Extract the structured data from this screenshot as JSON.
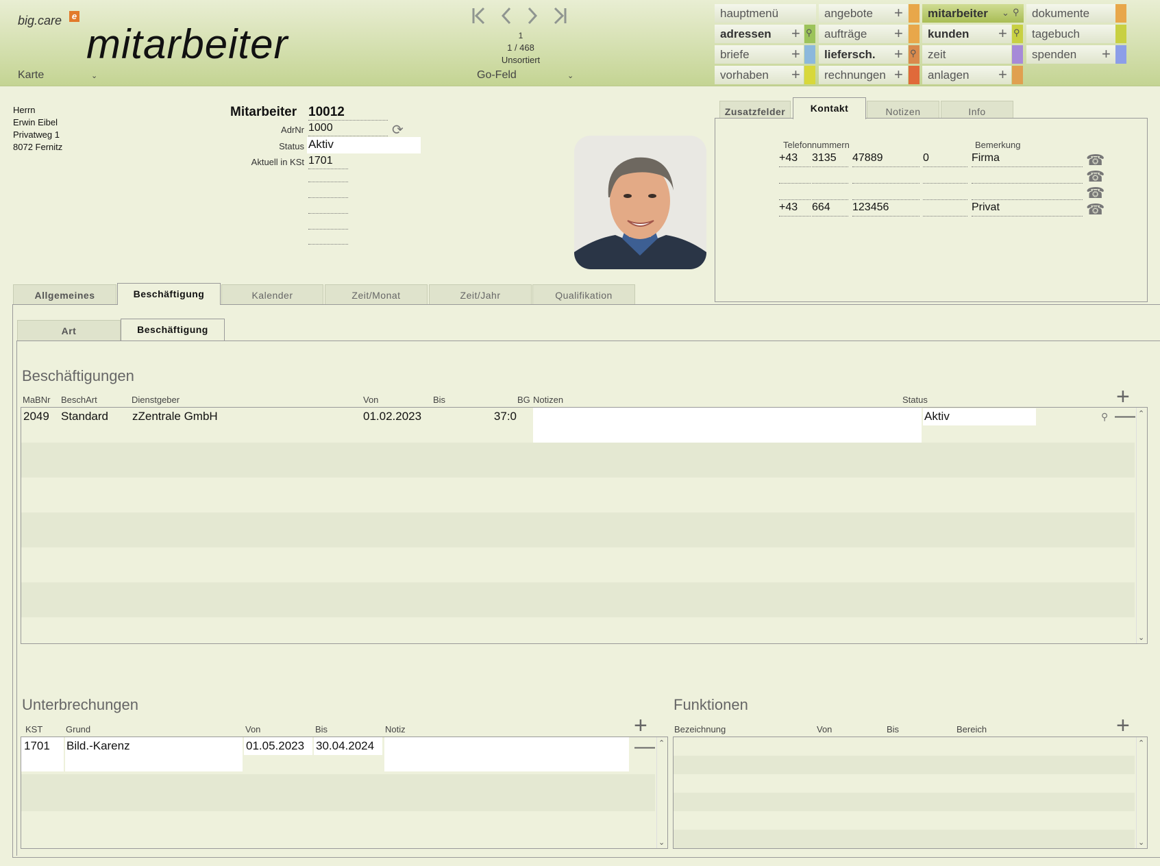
{
  "header": {
    "logo_text": "big.care",
    "logo_mark": "e",
    "module_title": "mitarbeiter",
    "view_select": "Karte",
    "record_number": "1",
    "record_count": "1 / 468",
    "sort_state": "Unsortiert",
    "go_field": "Go-Feld"
  },
  "nav_icons": [
    "first-record-icon",
    "previous-record-icon",
    "next-record-icon",
    "last-record-icon"
  ],
  "menu": {
    "hauptmenue": "hauptmenü",
    "angebote": "angebote",
    "mitarbeiter": "mitarbeiter",
    "dokumente": "dokumente",
    "adressen": "adressen",
    "auftraege": "aufträge",
    "kunden": "kunden",
    "tagebuch": "tagebuch",
    "briefe": "briefe",
    "liefersch": "liefersch.",
    "zeit": "zeit",
    "spenden": "spenden",
    "vorhaben": "vorhaben",
    "rechnungen": "rechnungen",
    "anlagen": "anlagen"
  },
  "menu_colors": {
    "angebote": "#e8a74a",
    "dokumente": "#e8a74a",
    "adressen": "#9cc35a",
    "auftraege": "#e8a74a",
    "kunden": "#c8d042",
    "tagebuch": "#c8d042",
    "briefe": "#8cb8dc",
    "liefersch": "#d98a4c",
    "zeit": "#a68ad8",
    "spenden": "#8c9ee8",
    "vorhaben": "#d8d83a",
    "rechnungen": "#e06a3a",
    "anlagen": "#e0a050"
  },
  "address": {
    "salutation": "Herrn",
    "name": "Erwin Eibel",
    "street": "Privatweg 1",
    "city": "8072 Fernitz"
  },
  "employee": {
    "label": "Mitarbeiter",
    "number": "10012",
    "adrnr_label": "AdrNr",
    "adrnr": "1000",
    "status_label": "Status",
    "status": "Aktiv",
    "kst_label": "Aktuell in KSt",
    "kst": "1701"
  },
  "right_tabs": {
    "zusatzfelder": "Zusatzfelder",
    "kontakt": "Kontakt",
    "notizen": "Notizen",
    "info": "Info"
  },
  "contact": {
    "phone_header": "Telefonnummern",
    "remark_header": "Bemerkung",
    "phones": [
      {
        "cc": "+43",
        "area": "3135",
        "number": "47889",
        "ext": "0",
        "remark": "Firma"
      },
      {
        "cc": "",
        "area": "",
        "number": "",
        "ext": "",
        "remark": ""
      },
      {
        "cc": "",
        "area": "",
        "number": "",
        "ext": "",
        "remark": ""
      },
      {
        "cc": "+43",
        "area": "664",
        "number": "123456",
        "ext": "",
        "remark": "Privat"
      }
    ]
  },
  "main_tabs": {
    "allgemeines": "Allgemeines",
    "beschaeftigung": "Beschäftigung",
    "kalender": "Kalender",
    "zeit_monat": "Zeit/Monat",
    "zeit_jahr": "Zeit/Jahr",
    "qualifikation": "Qualifikation"
  },
  "sub_tabs": {
    "art": "Art",
    "beschaeftigung": "Beschäftigung"
  },
  "employments": {
    "title": "Beschäftigungen",
    "columns": {
      "mabnr": "MaBNr",
      "beschart": "BeschArt",
      "dienstgeber": "Dienstgeber",
      "von": "Von",
      "bis": "Bis",
      "bg": "BG",
      "notizen": "Notizen",
      "status": "Status"
    },
    "rows": [
      {
        "mabnr": "2049",
        "beschart": "Standard",
        "dienstgeber": "zZentrale GmbH",
        "von": "01.02.2023",
        "bis": "",
        "bg": "37:0",
        "notizen": "",
        "status": "Aktiv"
      }
    ]
  },
  "interruptions": {
    "title": "Unterbrechungen",
    "columns": {
      "kst": "KST",
      "grund": "Grund",
      "von": "Von",
      "bis": "Bis",
      "notiz": "Notiz"
    },
    "rows": [
      {
        "kst": "1701",
        "grund": "Bild.-Karenz",
        "von": "01.05.2023",
        "bis": "30.04.2024",
        "notiz": ""
      }
    ]
  },
  "functions": {
    "title": "Funktionen",
    "columns": {
      "bezeichnung": "Bezeichnung",
      "von": "Von",
      "bis": "Bis",
      "bereich": "Bereich"
    }
  }
}
